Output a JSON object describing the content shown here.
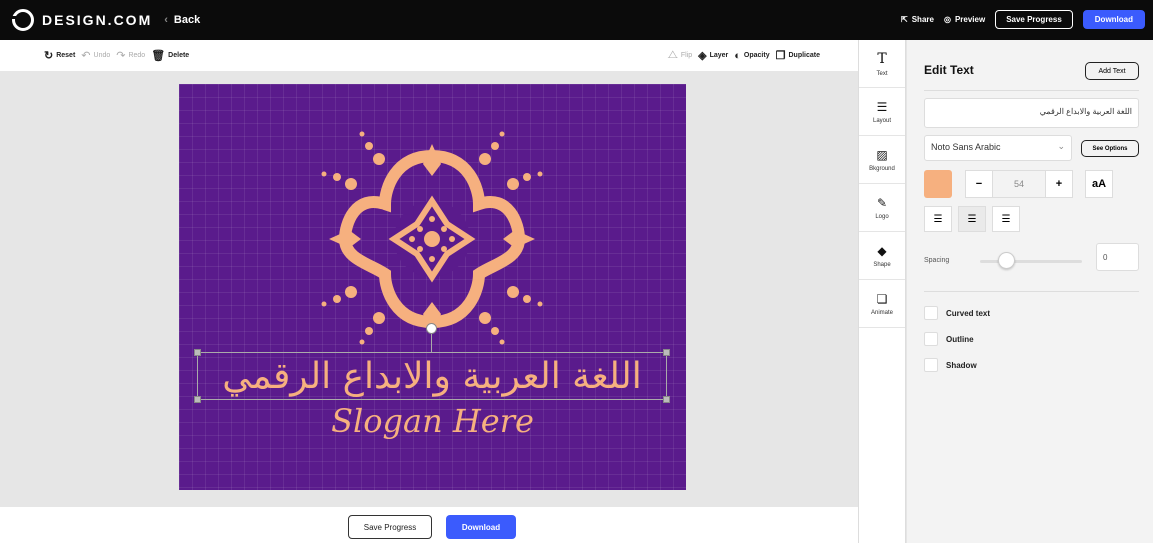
{
  "brand": {
    "name": "DESIGN.COM"
  },
  "topbar": {
    "back_label": "Back",
    "share_label": "Share",
    "preview_label": "Preview",
    "save_progress_label": "Save Progress",
    "download_label": "Download"
  },
  "toolbar": {
    "reset": "Reset",
    "undo": "Undo",
    "redo": "Redo",
    "delete": "Delete",
    "flip": "Flip",
    "layer": "Layer",
    "opacity": "Opacity",
    "duplicate": "Duplicate"
  },
  "artboard": {
    "background_color": "#5a1b8c",
    "accent_color": "#f6b07f",
    "arabic_text": "اللغة العربية والابداع الرقمي",
    "slogan_text": "Slogan Here"
  },
  "bottombar": {
    "save_progress_label": "Save Progress",
    "download_label": "Download"
  },
  "sidenav": {
    "items": [
      {
        "label": "Text",
        "icon": "text-icon"
      },
      {
        "label": "Layout",
        "icon": "layout-icon"
      },
      {
        "label": "Bkground",
        "icon": "background-icon"
      },
      {
        "label": "Logo",
        "icon": "logo-icon"
      },
      {
        "label": "Shape",
        "icon": "shape-icon"
      },
      {
        "label": "Animate",
        "icon": "animate-icon"
      }
    ]
  },
  "panel": {
    "title": "Edit Text",
    "add_text_label": "Add Text",
    "text_value": "اللغة العربية والابداع الرقمي",
    "font_family_value": "Noto Sans Arabic",
    "see_options_label": "See Options",
    "color": "#f6b07f",
    "font_size": "54",
    "minus_label": "−",
    "plus_label": "+",
    "case_label": "aA",
    "spacing_label": "Spacing",
    "spacing_value": "0",
    "checkboxes": {
      "curved": "Curved text",
      "outline": "Outline",
      "shadow": "Shadow"
    }
  }
}
